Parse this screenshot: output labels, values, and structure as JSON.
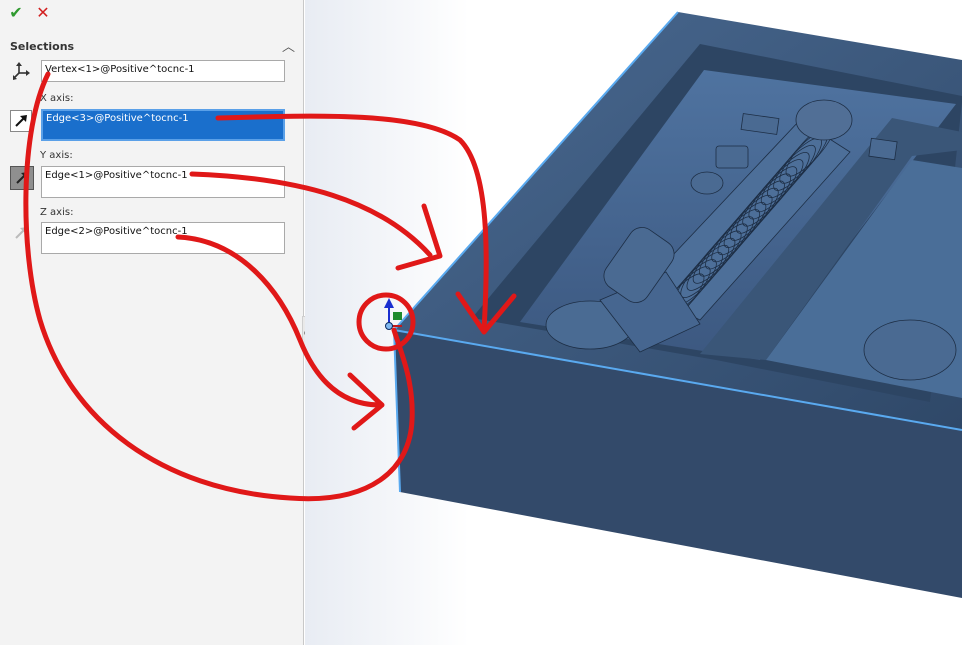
{
  "property_manager": {
    "confirm_icon": "checkmark-icon",
    "cancel_icon": "x-icon",
    "section": {
      "title": "Selections"
    },
    "origin_field": {
      "value": "Vertex<1>@Positive^tocnc-1"
    },
    "x_axis": {
      "label": "X axis:",
      "value": "Edge<3>@Positive^tocnc-1"
    },
    "y_axis": {
      "label": "Y axis:",
      "value": "Edge<1>@Positive^tocnc-1"
    },
    "z_axis": {
      "label": "Z axis:",
      "value": "Edge<2>@Positive^tocnc-1"
    }
  },
  "colors": {
    "panel_bg": "#f3f3f3",
    "active_field": "#1a6fcc",
    "model_face": "#3a5272",
    "model_front": "#334a6a",
    "edge_highlight": "#5aaaf0",
    "annotation_red": "#e01818"
  }
}
